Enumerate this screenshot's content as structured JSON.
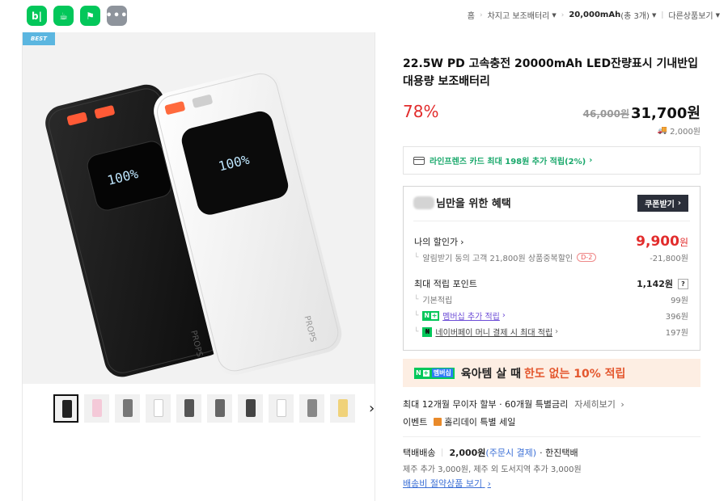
{
  "topbar": {
    "apps": [
      {
        "icon": "blog-icon",
        "glyph": "b|"
      },
      {
        "icon": "cafe-icon",
        "glyph": "☕"
      },
      {
        "icon": "bookmark-icon",
        "glyph": "⚑"
      },
      {
        "icon": "more-apps-icon",
        "glyph": "•••"
      }
    ],
    "breadcrumb": {
      "home": "홈",
      "category": "차지고 보조배터리",
      "filter": "20,000mAh",
      "filter_count": "(총 3개)",
      "other": "다른상품보기"
    }
  },
  "gallery": {
    "badge": "BEST",
    "thumb_count": 10
  },
  "product": {
    "title": "22.5W PD 고속충전 20000mAh LED잔량표시 기내반입 대용량 보조배터리",
    "discount_rate": "78%",
    "original_price": "46,000원",
    "sale_price": "31,700원",
    "shipping_fee": "2,000원",
    "card_offer": "라인프렌즈 카드 최대 198원 추가 적립(2%)",
    "card_offer_arrow": "›"
  },
  "benefit": {
    "heading": "님만을 위한 혜택",
    "coupon_button": "쿠폰받기",
    "my_price_label": "나의 할인가",
    "my_price": "9,900",
    "my_price_unit": "원",
    "notify_label": "알림받기 동의 고객 21,800원 상품중복할인",
    "notify_badge": "D-2",
    "notify_value": "-21,800원",
    "points_label": "최대 적립 포인트",
    "points_value": "1,142원",
    "points_help": "?",
    "basic_label": "기본적립",
    "basic_value": "99원",
    "membership_label": "멤버십 추가 적립",
    "membership_value": "396원",
    "npay_label": "네이버페이 머니 결제 시 최대 적립",
    "npay_value": "197원"
  },
  "promo": {
    "badge_n": "N",
    "badge_plus": "+",
    "badge_text": "멤버십",
    "text_plain": "육아템 살 때",
    "text_accent": "한도 없는 10% 적립"
  },
  "installment": {
    "text": "최대 12개월 무이자 할부 · 60개월 특별금리",
    "more": "자세히보기"
  },
  "event": {
    "label": "이벤트",
    "text": "홀리데이 특별 세일"
  },
  "delivery": {
    "type": "택배배송",
    "fee": "2,000원",
    "fee_note": "(주문시 결제)",
    "carrier": "· 한진택배",
    "extra": "제주 추가 3,000원, 제주 외 도서지역 추가 3,000원",
    "save_link": "배송비 절약상품 보기"
  },
  "colors": {
    "naver_green": "#03c75a",
    "discount_red": "#e22c2c",
    "promo_bg": "#fdeee3",
    "promo_accent": "#e4572e"
  }
}
